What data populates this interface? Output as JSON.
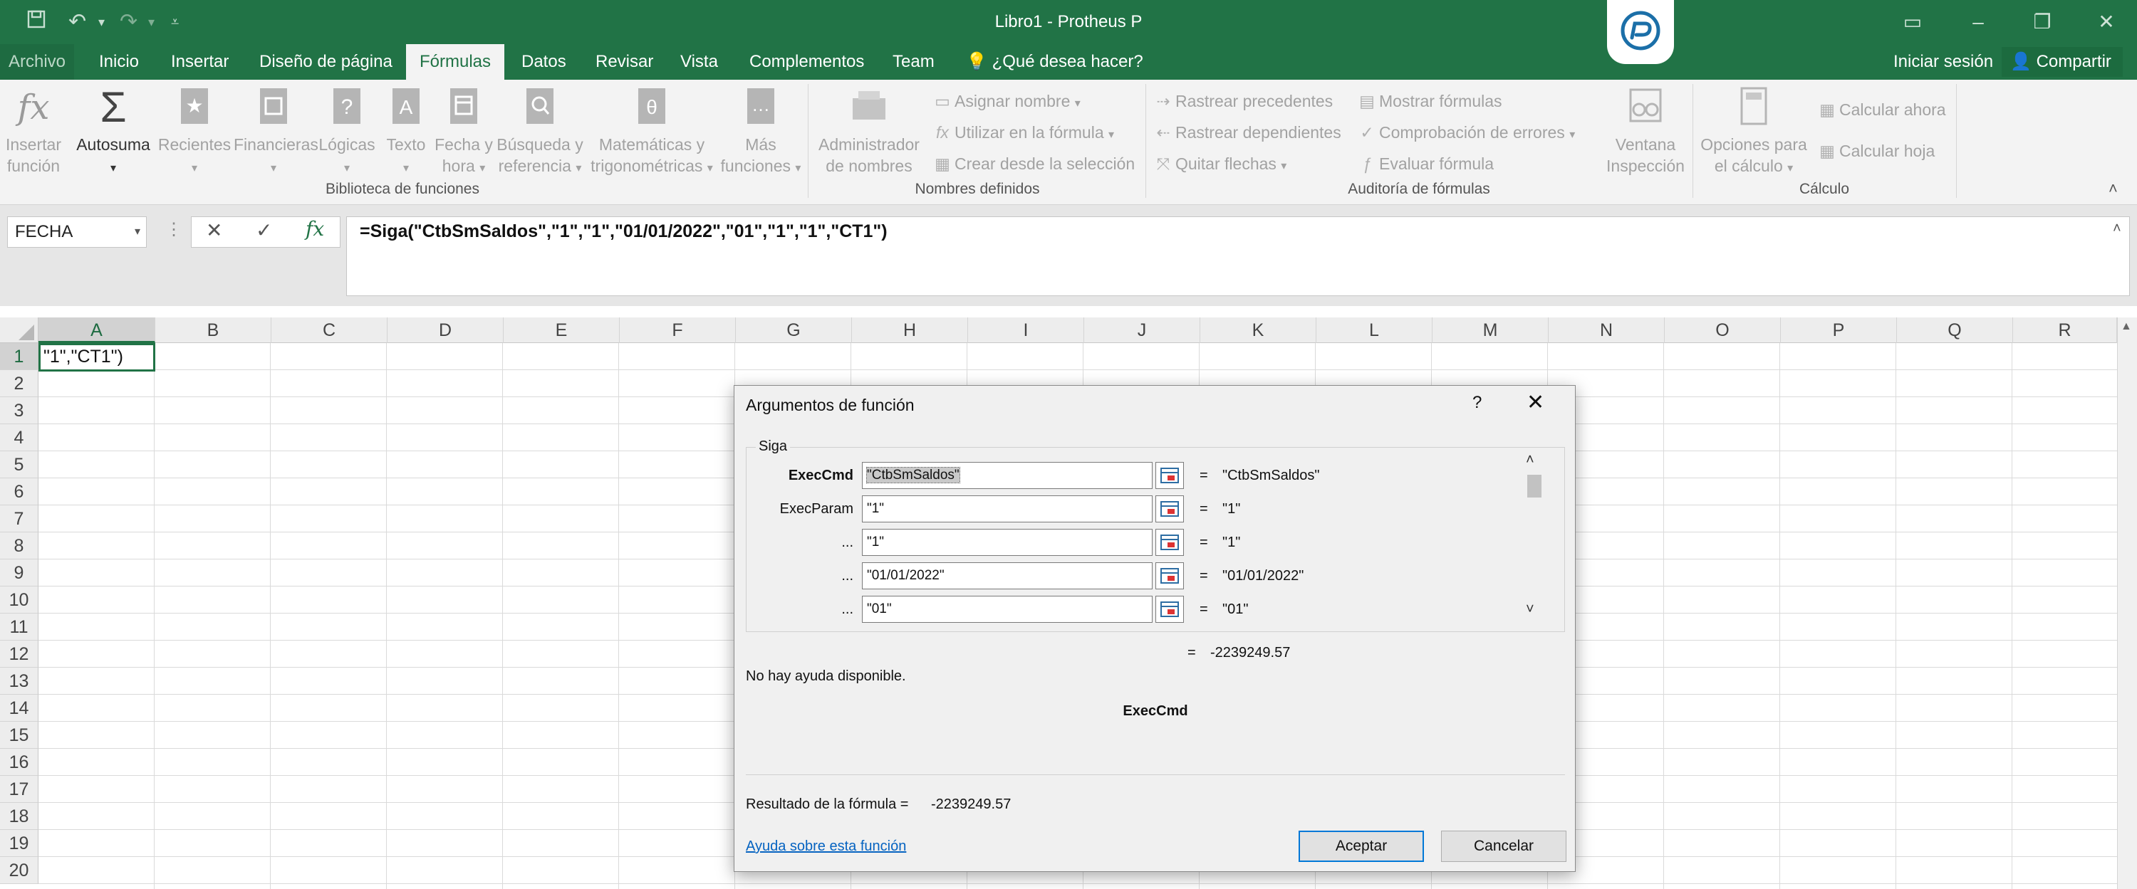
{
  "window": {
    "title": "Libro1 - Protheus P"
  },
  "tabs": {
    "file": "Archivo",
    "items": [
      "Inicio",
      "Insertar",
      "Diseño de página",
      "Fórmulas",
      "Datos",
      "Revisar",
      "Vista",
      "Complementos",
      "Team"
    ],
    "active": "Fórmulas",
    "tell_me": "¿Qué desea hacer?",
    "sign_in": "Iniciar sesión",
    "share": "Compartir"
  },
  "ribbon": {
    "insert_function": [
      "Insertar",
      "función"
    ],
    "autosum": "Autosuma",
    "recent": "Recientes",
    "financial": "Financieras",
    "logical": "Lógicas",
    "text": "Texto",
    "datetime": [
      "Fecha y",
      "hora"
    ],
    "lookup": [
      "Búsqueda y",
      "referencia"
    ],
    "math": [
      "Matemáticas y",
      "trigonométricas"
    ],
    "more": [
      "Más",
      "funciones"
    ],
    "group_library": "Biblioteca de funciones",
    "name_manager": [
      "Administrador",
      "de nombres"
    ],
    "define_name": "Asignar nombre",
    "use_in_formula": "Utilizar en la fórmula",
    "create_from_selection": "Crear desde la selección",
    "group_names": "Nombres definidos",
    "trace_precedents": "Rastrear precedentes",
    "trace_dependents": "Rastrear dependientes",
    "remove_arrows": "Quitar flechas",
    "show_formulas": "Mostrar fórmulas",
    "error_checking": "Comprobación de errores",
    "evaluate_formula": "Evaluar fórmula",
    "watch_window": [
      "Ventana",
      "Inspección"
    ],
    "group_audit": "Auditoría de fórmulas",
    "calc_options": [
      "Opciones para",
      "el cálculo"
    ],
    "calc_now": "Calcular ahora",
    "calc_sheet": "Calcular hoja",
    "group_calc": "Cálculo"
  },
  "formula_bar": {
    "name_box": "FECHA",
    "formula": "=Siga(\"CtbSmSaldos\",\"1\",\"1\",\"01/01/2022\",\"01\",\"1\",\"1\",\"CT1\")"
  },
  "sheet": {
    "columns": [
      "A",
      "B",
      "C",
      "D",
      "E",
      "F",
      "G",
      "H",
      "I",
      "J",
      "K",
      "L",
      "M",
      "N",
      "O",
      "P",
      "Q",
      "R"
    ],
    "rows": [
      "1",
      "2",
      "3",
      "4",
      "5",
      "6",
      "7",
      "8",
      "9",
      "10",
      "11",
      "12",
      "13",
      "14",
      "15",
      "16",
      "17",
      "18",
      "19",
      "20"
    ],
    "active_cell_text": "\"1\",\"CT1\")"
  },
  "dialog": {
    "title": "Argumentos de función",
    "help": "?",
    "function_name": "Siga",
    "args": [
      {
        "label": "ExecCmd",
        "value": "\"CtbSmSaldos\"",
        "result": "\"CtbSmSaldos\""
      },
      {
        "label": "ExecParam",
        "value": "\"1\"",
        "result": "\"1\""
      },
      {
        "label": "...",
        "value": "\"1\"",
        "result": "\"1\""
      },
      {
        "label": "...",
        "value": "\"01/01/2022\"",
        "result": "\"01/01/2022\""
      },
      {
        "label": "...",
        "value": "\"01\"",
        "result": "\"01\""
      }
    ],
    "eq": "=",
    "total_result": "-2239249.57",
    "no_help": "No hay ayuda disponible.",
    "arg_name": "ExecCmd",
    "formula_result_label": "Resultado de la fórmula =",
    "formula_result_value": "-2239249.57",
    "help_link": "Ayuda sobre esta función",
    "ok": "Aceptar",
    "cancel": "Cancelar"
  }
}
